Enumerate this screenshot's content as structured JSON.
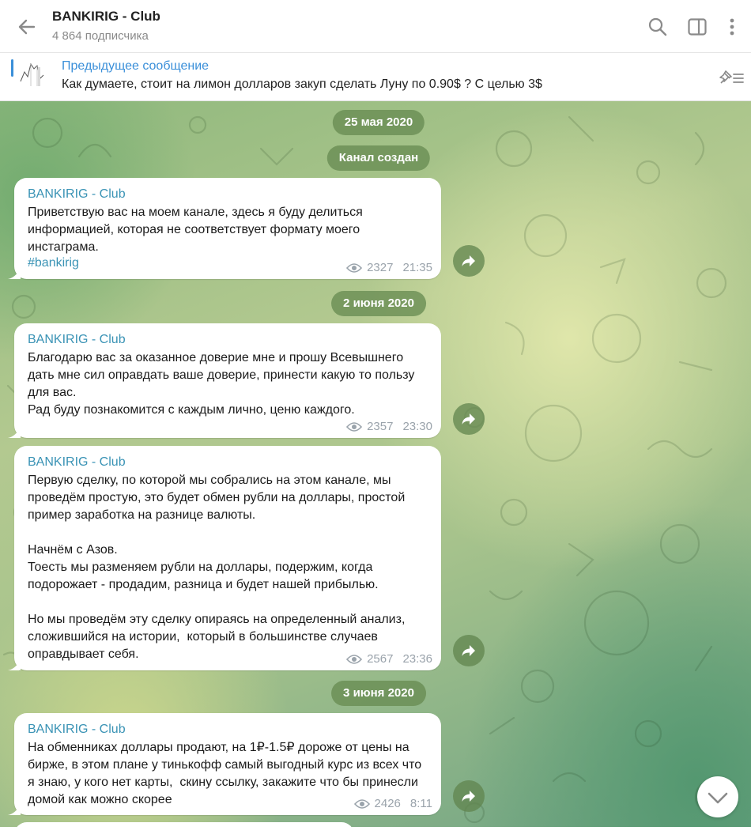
{
  "header": {
    "title": "BANKIRIG - Club",
    "subtitle": "4 864 подписчика"
  },
  "pinned": {
    "title": "Предыдущее сообщение",
    "text": "Как думаете, стоит на лимон долларов закуп сделать Луну по 0.90$ ? С целью 3$"
  },
  "dates": [
    "25 мая 2020",
    "Канал создан",
    "2 июня 2020",
    "3 июня 2020"
  ],
  "messages": [
    {
      "author": "BANKIRIG - Club",
      "text": "Приветствую вас на моем канале, здесь я буду делиться информацией, которая не соответствует формату моего инстаграма.",
      "hashtag": "#bankirig",
      "views": "2327",
      "time": "21:35"
    },
    {
      "author": "BANKIRIG - Club",
      "text": "Благодарю вас за оказанное доверие мне и прошу Всевышнего дать мне сил оправдать ваше доверие, принести какую то пользу для вас.\nРад буду познакомится с каждым лично, ценю каждого.",
      "views": "2357",
      "time": "23:30"
    },
    {
      "author": "BANKIRIG - Club",
      "text": "Первую сделку, по которой мы собрались на этом канале, мы проведём простую, это будет обмен рубли на доллары, простой пример заработка на разнице валюты.\n\nНачнём с Азов.\nТоесть мы разменяем рубли на доллары, подержим, когда подорожает - продадим, разница и будет нашей прибылью.\n\nНо мы проведём эту сделку опираясь на определенный анализ, сложившийся на истории,  который в большинстве случаев оправдывает себя.",
      "views": "2567",
      "time": "23:36"
    },
    {
      "author": "BANKIRIG - Club",
      "text": "На обменниках доллары продают, на 1₽-1.5₽ дороже от цены на бирже, в этом плане у тинькофф самый выгодный курс из всех что я знаю, у кого нет карты,  скину ссылку, закажите что бы принесли домой как можно скорее",
      "views": "2426",
      "time": "8:11"
    }
  ],
  "icons": {
    "back": "arrow-left-icon",
    "search": "search-icon",
    "sidebar": "sidebar-toggle-icon",
    "more": "more-vertical-icon",
    "pinned_list": "pin-list-icon",
    "views": "eye-icon",
    "forward": "forward-icon",
    "scroll_down": "chevron-down-icon"
  },
  "colors": {
    "accent": "#3a8fd9",
    "author": "#3a93b5",
    "date_pill": "#688c52"
  }
}
